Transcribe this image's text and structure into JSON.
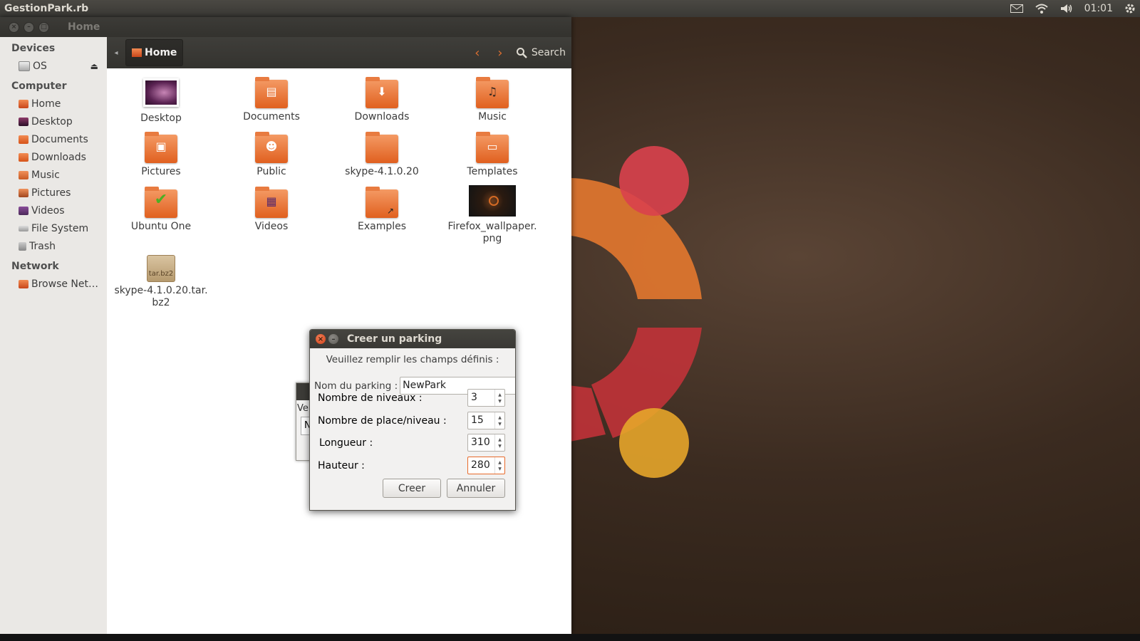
{
  "top_panel": {
    "app_title": "GestionPark.rb",
    "clock": "01:01",
    "icons": [
      "mail-icon",
      "wifi-icon",
      "volume-icon",
      "gear-icon"
    ]
  },
  "file_manager": {
    "window_title": "Home",
    "path_crumb": "Home",
    "search_label": "Search",
    "sidebar": {
      "sections": [
        {
          "header": "Devices",
          "items": [
            {
              "label": "OS",
              "icon": "drive-icon"
            }
          ]
        },
        {
          "header": "Computer",
          "items": [
            {
              "label": "Home",
              "icon": "home-folder-icon"
            },
            {
              "label": "Desktop",
              "icon": "desktop-icon"
            },
            {
              "label": "Documents",
              "icon": "documents-folder-icon"
            },
            {
              "label": "Downloads",
              "icon": "downloads-folder-icon"
            },
            {
              "label": "Music",
              "icon": "music-folder-icon"
            },
            {
              "label": "Pictures",
              "icon": "pictures-folder-icon"
            },
            {
              "label": "Videos",
              "icon": "videos-folder-icon"
            },
            {
              "label": "File System",
              "icon": "filesystem-icon"
            },
            {
              "label": "Trash",
              "icon": "trash-icon"
            }
          ]
        },
        {
          "header": "Network",
          "items": [
            {
              "label": "Browse Net…",
              "icon": "network-icon"
            }
          ]
        }
      ]
    },
    "files": [
      {
        "name": "Desktop",
        "icon": "desktop-thumbnail"
      },
      {
        "name": "Documents",
        "icon": "documents-folder-icon"
      },
      {
        "name": "Downloads",
        "icon": "downloads-folder-icon"
      },
      {
        "name": "Music",
        "icon": "music-folder-icon"
      },
      {
        "name": "Pictures",
        "icon": "pictures-folder-icon"
      },
      {
        "name": "Public",
        "icon": "public-folder-icon"
      },
      {
        "name": "skype-4.1.0.20",
        "icon": "folder-icon"
      },
      {
        "name": "Templates",
        "icon": "templates-folder-icon"
      },
      {
        "name": "Ubuntu One",
        "icon": "ubuntu-one-folder-icon"
      },
      {
        "name": "Videos",
        "icon": "videos-folder-icon"
      },
      {
        "name": "Examples",
        "icon": "link-folder-icon"
      },
      {
        "name": "Firefox_wallpaper.",
        "name2": "png",
        "icon": "image-thumbnail"
      },
      {
        "name": "skype-4.1.0.20.tar.",
        "name2": "bz2",
        "icon": "archive-icon",
        "badge": "tar.bz2"
      }
    ]
  },
  "background_dialog": {
    "text1": "Ve",
    "text2": "N"
  },
  "dialog": {
    "title": "Creer un parking",
    "intro": "Veuillez remplir les champs définis :",
    "name_label": "Nom du parking :",
    "name_value": "NewPark",
    "fields": [
      {
        "label": "Nombre de niveaux :",
        "value": "3"
      },
      {
        "label": "Nombre de place/niveau :",
        "value": "15"
      },
      {
        "label": "Longueur :",
        "value": "310"
      },
      {
        "label": "Hauteur :",
        "value": "280"
      }
    ],
    "ok_label": "Creer",
    "cancel_label": "Annuler"
  },
  "colors": {
    "accent": "#dd4814",
    "folder": "#e9692c",
    "panel": "#3c3b37"
  }
}
